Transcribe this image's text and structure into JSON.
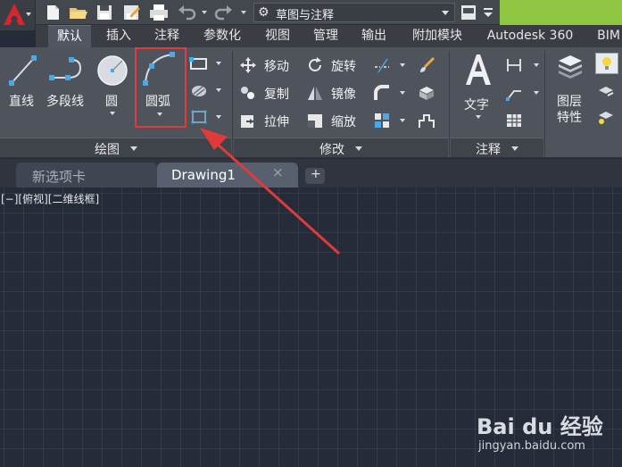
{
  "workspace": {
    "name": "草图与注释"
  },
  "ribbon_tabs": [
    "默认",
    "插入",
    "注释",
    "参数化",
    "视图",
    "管理",
    "输出",
    "附加模块",
    "Autodesk 360",
    "BIM"
  ],
  "draw_panel": {
    "title": "绘图",
    "line_label": "直线",
    "polyline_label": "多段线",
    "circle_label": "圆",
    "arc_label": "圆弧"
  },
  "modify_panel": {
    "title": "修改",
    "move": "移动",
    "rotate": "旋转",
    "copy": "复制",
    "mirror": "镜像",
    "stretch": "拉伸",
    "scale": "缩放"
  },
  "annotation_panel": {
    "title": "注释",
    "text_label": "文字"
  },
  "layers_panel": {
    "label_line1": "图层",
    "label_line2": "特性"
  },
  "doc_tabs": {
    "new_tab": "新选项卡",
    "drawing_tab": "Drawing1",
    "close_glyph": "×",
    "add_glyph": "+"
  },
  "viewport": {
    "label": "[−][俯视][二维线框]"
  },
  "watermark": {
    "logo": "Bai du 经验",
    "url": "jingyan.baidu.com"
  },
  "colors": {
    "highlight": "#e03a3a",
    "arrow": "#e03a3a",
    "accent_green": "#8fc641",
    "canvas": "#252b38"
  }
}
